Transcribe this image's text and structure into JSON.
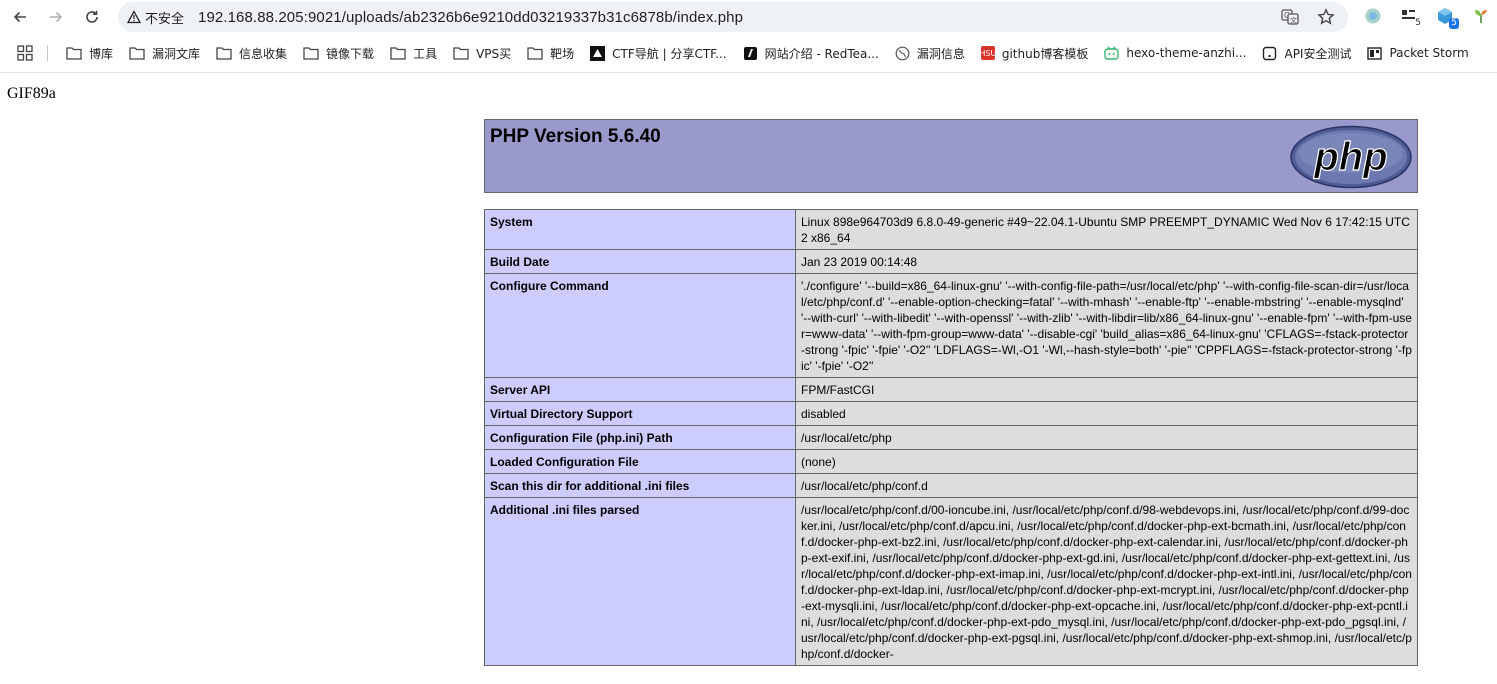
{
  "browser": {
    "security_label": "不安全",
    "url": "192.168.88.205:9021/uploads/ab2326b6e9210dd03219337b31c6878b/index.php",
    "ext_badges": [
      "5",
      "5"
    ]
  },
  "bookmarks": [
    {
      "label": "博库",
      "icon": "folder-icon"
    },
    {
      "label": "漏洞文库",
      "icon": "folder-icon"
    },
    {
      "label": "信息收集",
      "icon": "folder-icon"
    },
    {
      "label": "镜像下载",
      "icon": "folder-icon"
    },
    {
      "label": "工具",
      "icon": "folder-icon"
    },
    {
      "label": "VPS买",
      "icon": "folder-icon"
    },
    {
      "label": "靶场",
      "icon": "folder-icon"
    },
    {
      "label": "CTF导航 | 分享CTF...",
      "icon": "ctf-favicon"
    },
    {
      "label": "网站介绍 - RedTea...",
      "icon": "redteam-favicon"
    },
    {
      "label": "漏洞信息",
      "icon": "globe-icon"
    },
    {
      "label": "github博客模板",
      "icon": "hsu-favicon",
      "badge_text": "HSU"
    },
    {
      "label": "hexo-theme-anzhi...",
      "icon": "bilibili-favicon"
    },
    {
      "label": "API安全测试",
      "icon": "api-favicon"
    },
    {
      "label": "Packet Storm",
      "icon": "packetstorm-favicon"
    }
  ],
  "page": {
    "gif_header": "GIF89a",
    "php_version_title": "PHP Version 5.6.40",
    "logo_text": "php",
    "rows": [
      {
        "key": "System",
        "value": "Linux 898e964703d9 6.8.0-49-generic #49~22.04.1-Ubuntu SMP PREEMPT_DYNAMIC Wed Nov 6 17:42:15 UTC 2 x86_64"
      },
      {
        "key": "Build Date",
        "value": "Jan 23 2019 00:14:48"
      },
      {
        "key": "Configure Command",
        "value": "'./configure' '--build=x86_64-linux-gnu' '--with-config-file-path=/usr/local/etc/php' '--with-config-file-scan-dir=/usr/local/etc/php/conf.d' '--enable-option-checking=fatal' '--with-mhash' '--enable-ftp' '--enable-mbstring' '--enable-mysqlnd' '--with-curl' '--with-libedit' '--with-openssl' '--with-zlib' '--with-libdir=lib/x86_64-linux-gnu' '--enable-fpm' '--with-fpm-user=www-data' '--with-fpm-group=www-data' '--disable-cgi' 'build_alias=x86_64-linux-gnu' 'CFLAGS=-fstack-protector-strong '-fpic' '-fpie' '-O2'' 'LDFLAGS=-Wl,-O1 '-Wl,--hash-style=both' '-pie'' 'CPPFLAGS=-fstack-protector-strong '-fpic' '-fpie' '-O2''"
      },
      {
        "key": "Server API",
        "value": "FPM/FastCGI"
      },
      {
        "key": "Virtual Directory Support",
        "value": "disabled"
      },
      {
        "key": "Configuration File (php.ini) Path",
        "value": "/usr/local/etc/php"
      },
      {
        "key": "Loaded Configuration File",
        "value": "(none)"
      },
      {
        "key": "Scan this dir for additional .ini files",
        "value": "/usr/local/etc/php/conf.d"
      },
      {
        "key": "Additional .ini files parsed",
        "value": "/usr/local/etc/php/conf.d/00-ioncube.ini, /usr/local/etc/php/conf.d/98-webdevops.ini, /usr/local/etc/php/conf.d/99-docker.ini, /usr/local/etc/php/conf.d/apcu.ini, /usr/local/etc/php/conf.d/docker-php-ext-bcmath.ini, /usr/local/etc/php/conf.d/docker-php-ext-bz2.ini, /usr/local/etc/php/conf.d/docker-php-ext-calendar.ini, /usr/local/etc/php/conf.d/docker-php-ext-exif.ini, /usr/local/etc/php/conf.d/docker-php-ext-gd.ini, /usr/local/etc/php/conf.d/docker-php-ext-gettext.ini, /usr/local/etc/php/conf.d/docker-php-ext-imap.ini, /usr/local/etc/php/conf.d/docker-php-ext-intl.ini, /usr/local/etc/php/conf.d/docker-php-ext-ldap.ini, /usr/local/etc/php/conf.d/docker-php-ext-mcrypt.ini, /usr/local/etc/php/conf.d/docker-php-ext-mysqli.ini, /usr/local/etc/php/conf.d/docker-php-ext-opcache.ini, /usr/local/etc/php/conf.d/docker-php-ext-pcntl.ini, /usr/local/etc/php/conf.d/docker-php-ext-pdo_mysql.ini, /usr/local/etc/php/conf.d/docker-php-ext-pdo_pgsql.ini, /usr/local/etc/php/conf.d/docker-php-ext-pgsql.ini, /usr/local/etc/php/conf.d/docker-php-ext-shmop.ini, /usr/local/etc/php/conf.d/docker-"
      }
    ]
  }
}
